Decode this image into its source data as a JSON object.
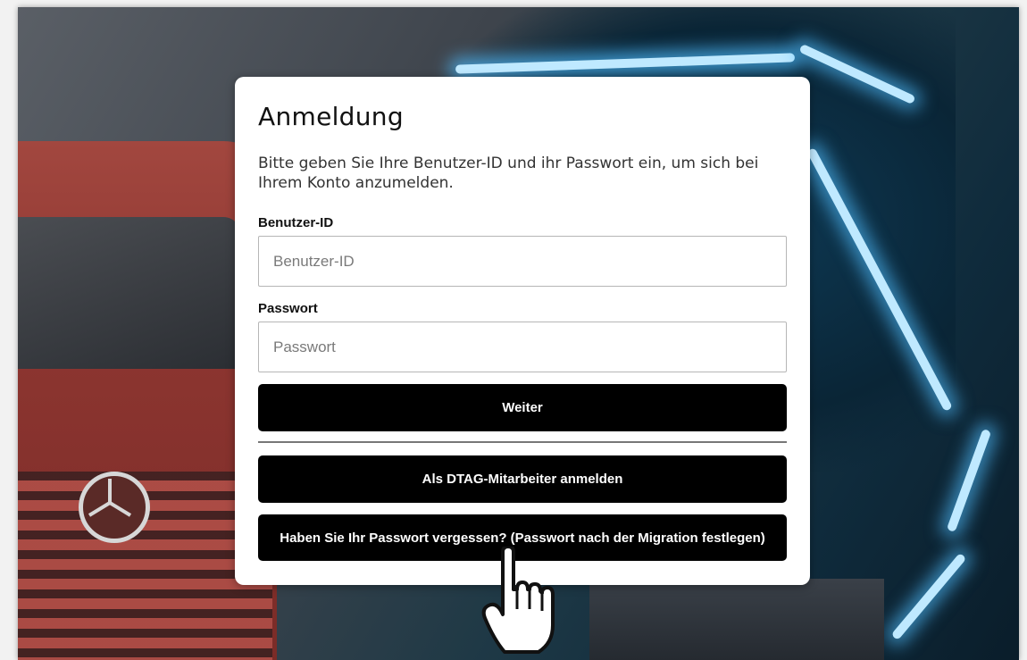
{
  "login": {
    "title": "Anmeldung",
    "subtitle": "Bitte geben Sie Ihre Benutzer-ID und ihr Passwort ein, um sich bei Ihrem Konto anzumelden.",
    "user_id_label": "Benutzer-ID",
    "user_id_placeholder": "Benutzer-ID",
    "user_id_value": "",
    "password_label": "Passwort",
    "password_placeholder": "Passwort",
    "password_value": "",
    "continue_button": "Weiter",
    "dtag_button": "Als DTAG-Mitarbeiter anmelden",
    "forgot_button": "Haben Sie Ihr Passwort vergessen? (Passwort nach der Migration festlegen)"
  },
  "background": {
    "scene": "truck-illustration",
    "accent_glow": "#6cc8ff",
    "truck_color": "#8c3530"
  },
  "cursor_icon": "hand-pointer-icon",
  "colors": {
    "card": "#ffffff",
    "button": "#000000",
    "button_text": "#ffffff"
  }
}
